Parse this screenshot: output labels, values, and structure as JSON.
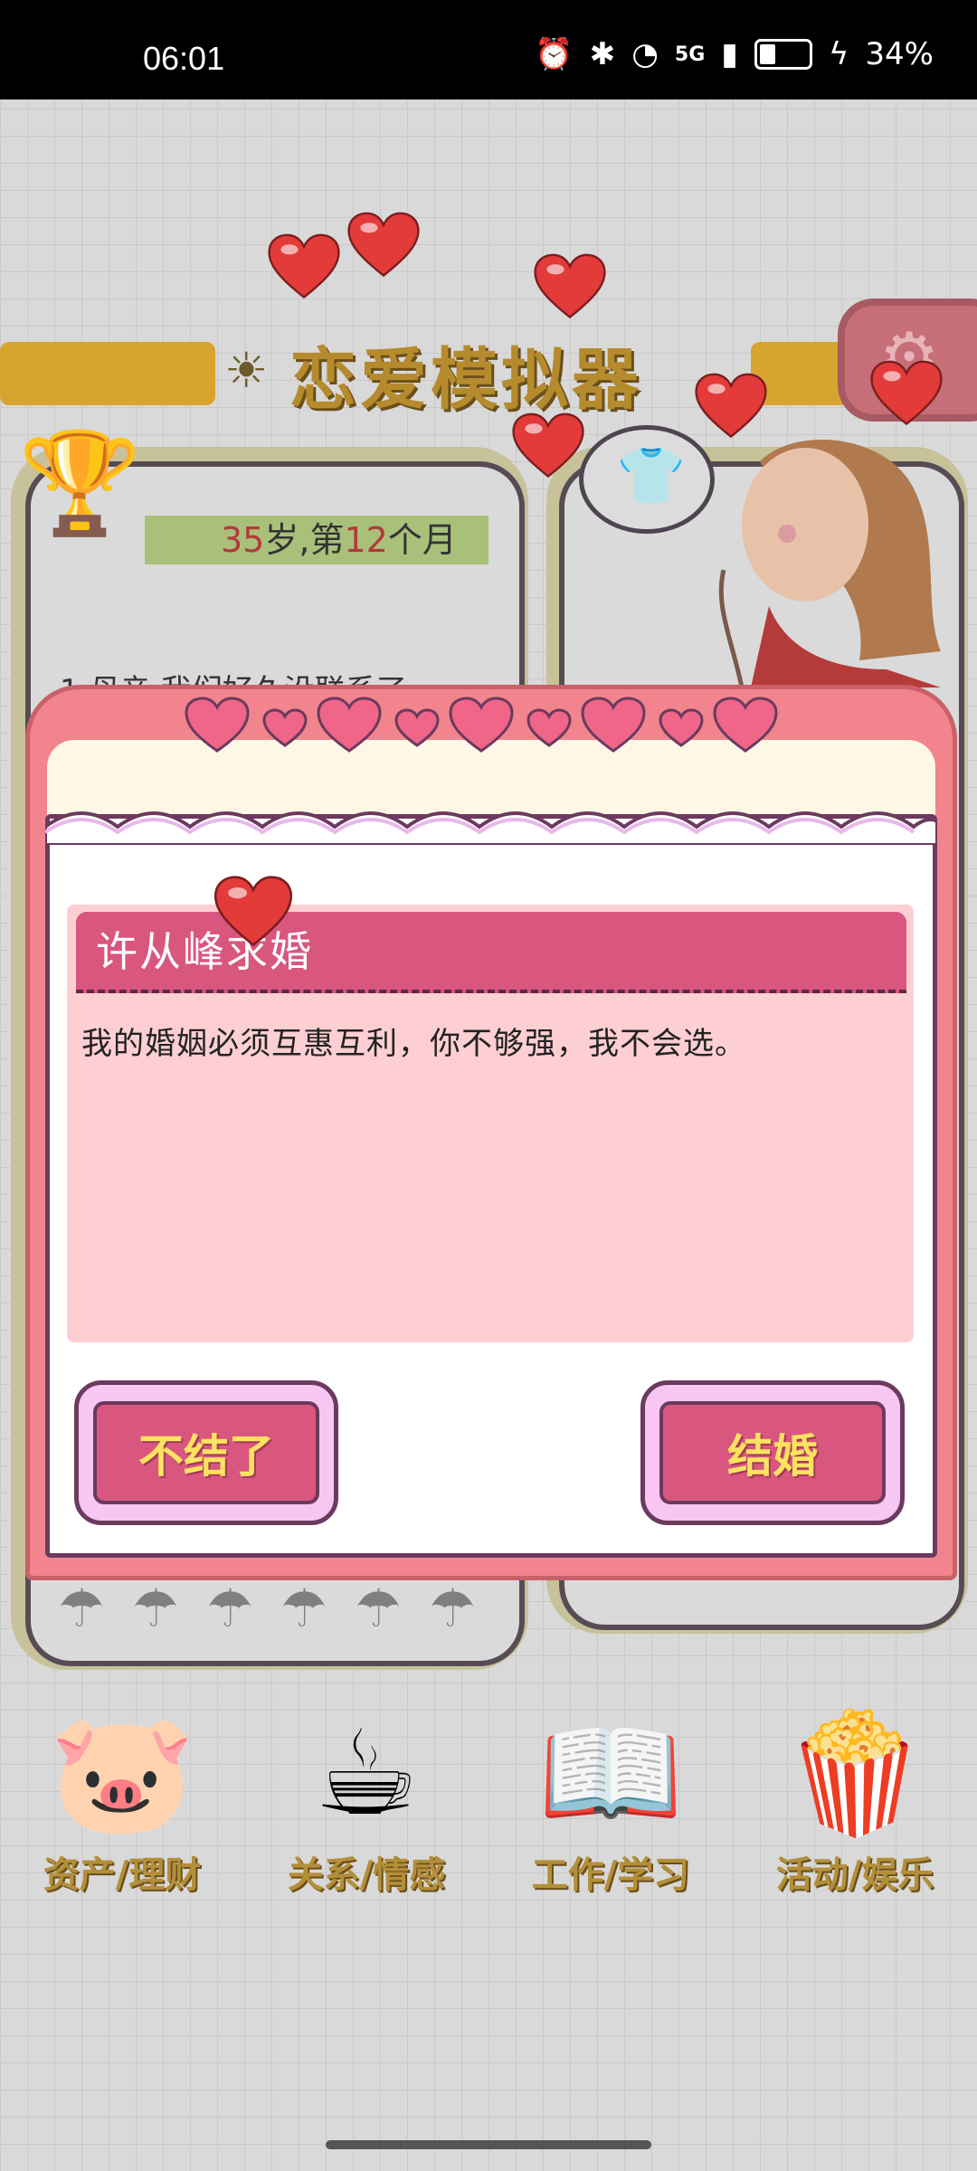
{
  "status_bar": {
    "time": "06:01",
    "network": "5G",
    "battery": "34%"
  },
  "app": {
    "title": "恋爱模拟器",
    "age_label_num1": "35",
    "age_label_mid": "岁,第",
    "age_label_num2": "12",
    "age_label_end": "个月",
    "event_preview": "1.母亲:我们好久没联系了"
  },
  "dialog": {
    "title": "许从峰求婚",
    "message": "我的婚姻必须互惠互利，你不够强，我不会选。",
    "decline_label": "不结了",
    "accept_label": "结婚"
  },
  "bottom_nav": [
    {
      "label": "资产/理财",
      "icon": "piggy-bank-icon"
    },
    {
      "label": "关系/情感",
      "icon": "coffee-cups-icon"
    },
    {
      "label": "工作/学习",
      "icon": "open-book-icon"
    },
    {
      "label": "活动/娱乐",
      "icon": "popcorn-icon"
    }
  ],
  "colors": {
    "dialog_pink": "#f1848c",
    "header_pink": "#d9567f",
    "button_text_yellow": "#fbe35f"
  }
}
